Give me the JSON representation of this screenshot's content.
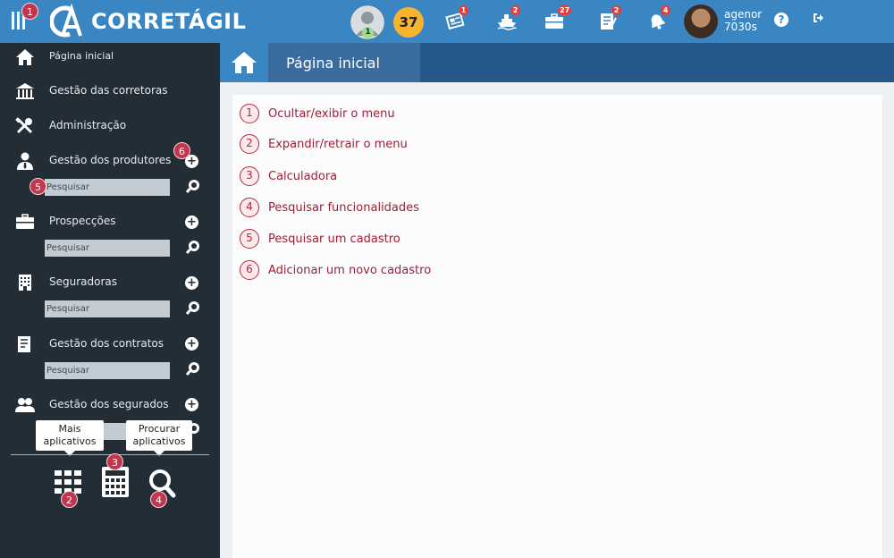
{
  "app": {
    "logo_text": "CORRETÁGIL",
    "menu_badge": "1"
  },
  "topbar": {
    "level_badge": "1",
    "score": "37",
    "notifications": [
      {
        "icon": "newspaper-icon",
        "count": "1"
      },
      {
        "icon": "ship-icon",
        "count": "2"
      },
      {
        "icon": "briefcase-icon",
        "count": "27"
      },
      {
        "icon": "contract-icon",
        "count": "2"
      },
      {
        "icon": "bell-icon",
        "count": "4"
      }
    ],
    "user_name": "agenor",
    "user_code": "7030s"
  },
  "sidebar": {
    "items": [
      {
        "label": "Página inicial",
        "icon": "home-icon"
      },
      {
        "label": "Gestão das corretoras",
        "icon": "building-columns-icon"
      },
      {
        "label": "Administração",
        "icon": "tools-icon"
      },
      {
        "label": "Gestão dos produtores",
        "icon": "user-tie-icon"
      },
      {
        "label": "Prospecções",
        "icon": "briefcase-icon"
      },
      {
        "label": "Seguradoras",
        "icon": "office-building-icon"
      },
      {
        "label": "Gestão dos contratos",
        "icon": "contract-icon"
      },
      {
        "label": "Gestão dos segurados",
        "icon": "users-icon"
      }
    ],
    "search_placeholder": "Pesquisar",
    "tooltip_more_apps": "Mais aplicativos",
    "tooltip_search_apps": "Procurar aplicativos",
    "badges": {
      "produtores_add": "6",
      "produtores_search": "5",
      "more_apps": "2",
      "calculator": "3",
      "search_apps": "4"
    }
  },
  "page": {
    "title": "Página inicial"
  },
  "legend": [
    {
      "num": "1",
      "text": "Ocultar/exibir o menu"
    },
    {
      "num": "2",
      "text": "Expandir/retrair o menu"
    },
    {
      "num": "3",
      "text": "Calculadora"
    },
    {
      "num": "4",
      "text": "Pesquisar funcionalidades"
    },
    {
      "num": "5",
      "text": "Pesquisar um cadastro"
    },
    {
      "num": "6",
      "text": "Adicionar um novo cadastro"
    }
  ],
  "colors": {
    "topbar": "#3a86c3",
    "sidebar": "#232d36",
    "accent_red": "#b3283f",
    "score": "#f6b431"
  }
}
